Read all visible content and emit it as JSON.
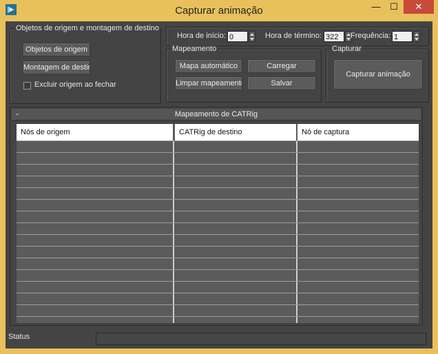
{
  "window": {
    "title": "Capturar animação",
    "minimize_glyph": "—",
    "maximize_glyph": "☐",
    "close_glyph": "✕",
    "accent": "#e8c15c",
    "close_color": "#c74a3c"
  },
  "group_source": {
    "title": "Objetos de origem e montagem de destino",
    "source_objects_button": "Objetos de origem",
    "dest_rig_button": "Montagem de destino",
    "exclude_checkbox_label": "Excluir origem ao fechar",
    "exclude_checked": false
  },
  "time": {
    "start_label": "Hora de início:",
    "start_value": "0",
    "end_label": "Hora de término:",
    "end_value": "322",
    "freq_label": "Frequência:",
    "freq_value": "1"
  },
  "mapping": {
    "title": "Mapeamento",
    "auto_map_button": "Mapa automático",
    "load_button": "Carregar",
    "clear_button": "Limpar mapeamento",
    "save_button": "Salvar"
  },
  "capture": {
    "title": "Capturar",
    "capture_button": "Capturar animação"
  },
  "mapping_panel": {
    "title": "Mapeamento de CATRig",
    "collapse_glyph": "-",
    "columns": [
      "Nós de origem",
      "CATRig de destino",
      "Nó de captura"
    ]
  },
  "status": {
    "label": "Status",
    "text": ""
  }
}
